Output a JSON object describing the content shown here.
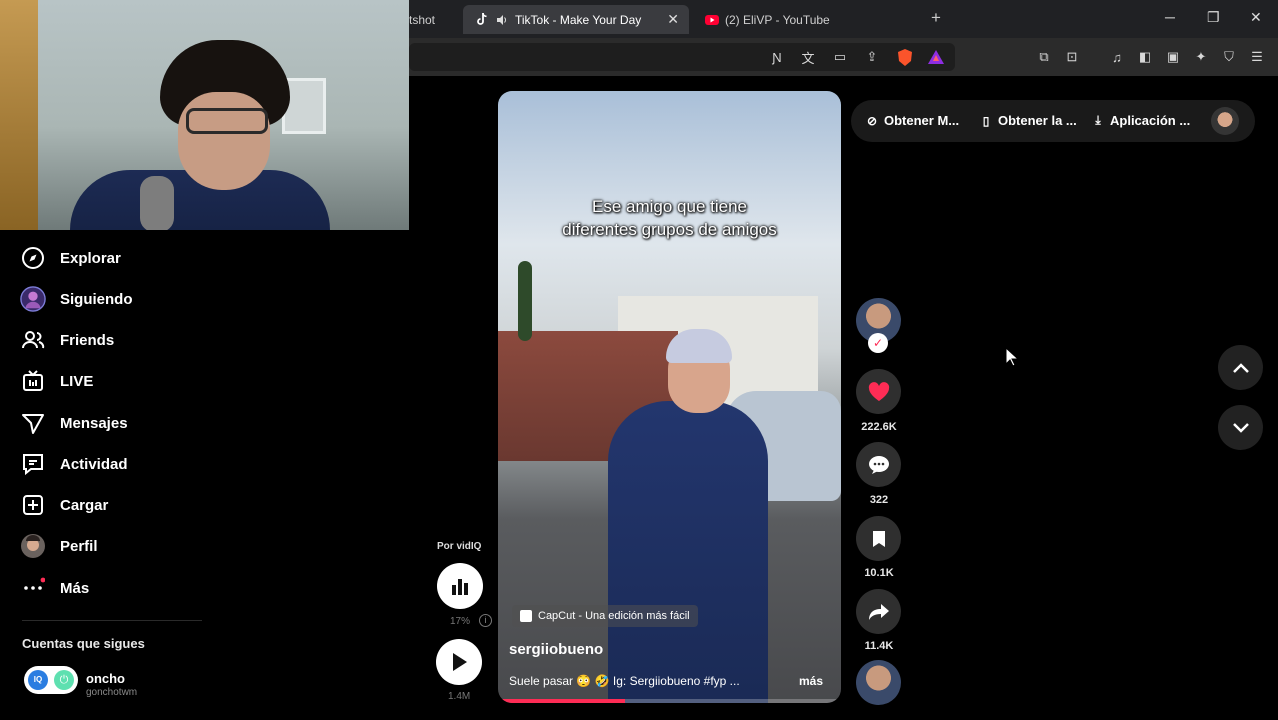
{
  "browser": {
    "tabs": [
      {
        "label": "tshot",
        "active": false
      },
      {
        "label": "TikTok - Make Your Day",
        "active": true
      },
      {
        "label": "(2) EliVP - YouTube",
        "active": false
      }
    ],
    "new_tab": "+",
    "close": "✕"
  },
  "sidebar": {
    "items": [
      {
        "label": "Explorar",
        "icon": "compass-icon"
      },
      {
        "label": "Siguiendo",
        "icon": "following-avatar-icon"
      },
      {
        "label": "Friends",
        "icon": "friends-icon"
      },
      {
        "label": "LIVE",
        "icon": "live-icon"
      },
      {
        "label": "Mensajes",
        "icon": "send-icon"
      },
      {
        "label": "Actividad",
        "icon": "activity-icon"
      },
      {
        "label": "Cargar",
        "icon": "upload-icon"
      },
      {
        "label": "Perfil",
        "icon": "profile-avatar-icon"
      },
      {
        "label": "Más",
        "icon": "more-icon"
      }
    ],
    "following_title": "Cuentas que sigues",
    "account": {
      "name": "oncho",
      "handle": "gonchotwm",
      "badge1": "IQ",
      "badge2": "⏻"
    }
  },
  "vidiq": {
    "label": "Por vidIQ",
    "percent": "17%",
    "info": "i",
    "views": "1.4M"
  },
  "video": {
    "caption_line1": "Ese amigo que tiene",
    "caption_line2": "diferentes grupos de amigos",
    "capcut": "CapCut - Una edición más fácil",
    "username": "sergiiobueno",
    "description": "Suele pasar 😳 🤣 Ig: Sergiiobueno #fyp ...",
    "more": "más",
    "progress": 0.37
  },
  "actions": {
    "likes": "222.6K",
    "comments": "322",
    "saves": "10.1K",
    "shares": "11.4K"
  },
  "topbar": {
    "item1": "Obtener M...",
    "item2": "Obtener la ...",
    "item3": "Aplicación ..."
  },
  "colors": {
    "accent": "#fe2c55",
    "background": "#000000"
  }
}
